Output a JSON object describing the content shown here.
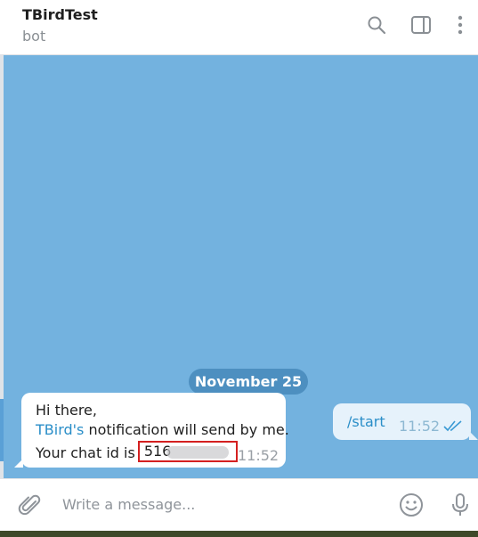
{
  "header": {
    "title": "TBirdTest",
    "subtitle": "bot",
    "icons": [
      "search-icon",
      "sidebar-toggle-icon",
      "more-vertical-icon"
    ]
  },
  "chat": {
    "date_separator": "November 25",
    "outgoing": {
      "text": "/start",
      "time": "11:52",
      "status": "read"
    },
    "incoming": {
      "line1": "Hi there,",
      "line2_link": "TBird's",
      "line2_rest": " notification will send by me.",
      "line3_prefix": "Your chat id is",
      "chat_id_visible": "516",
      "time": "11:52"
    }
  },
  "composer": {
    "placeholder": "Write a message...",
    "icons": [
      "attach-icon",
      "emoji-icon",
      "microphone-icon"
    ]
  },
  "colors": {
    "chat_background": "#73b2df",
    "date_pill": "#4d8fc0",
    "outgoing_bubble": "#e6f2fb",
    "link": "#2a8ec8",
    "highlight_box": "#d42020"
  }
}
